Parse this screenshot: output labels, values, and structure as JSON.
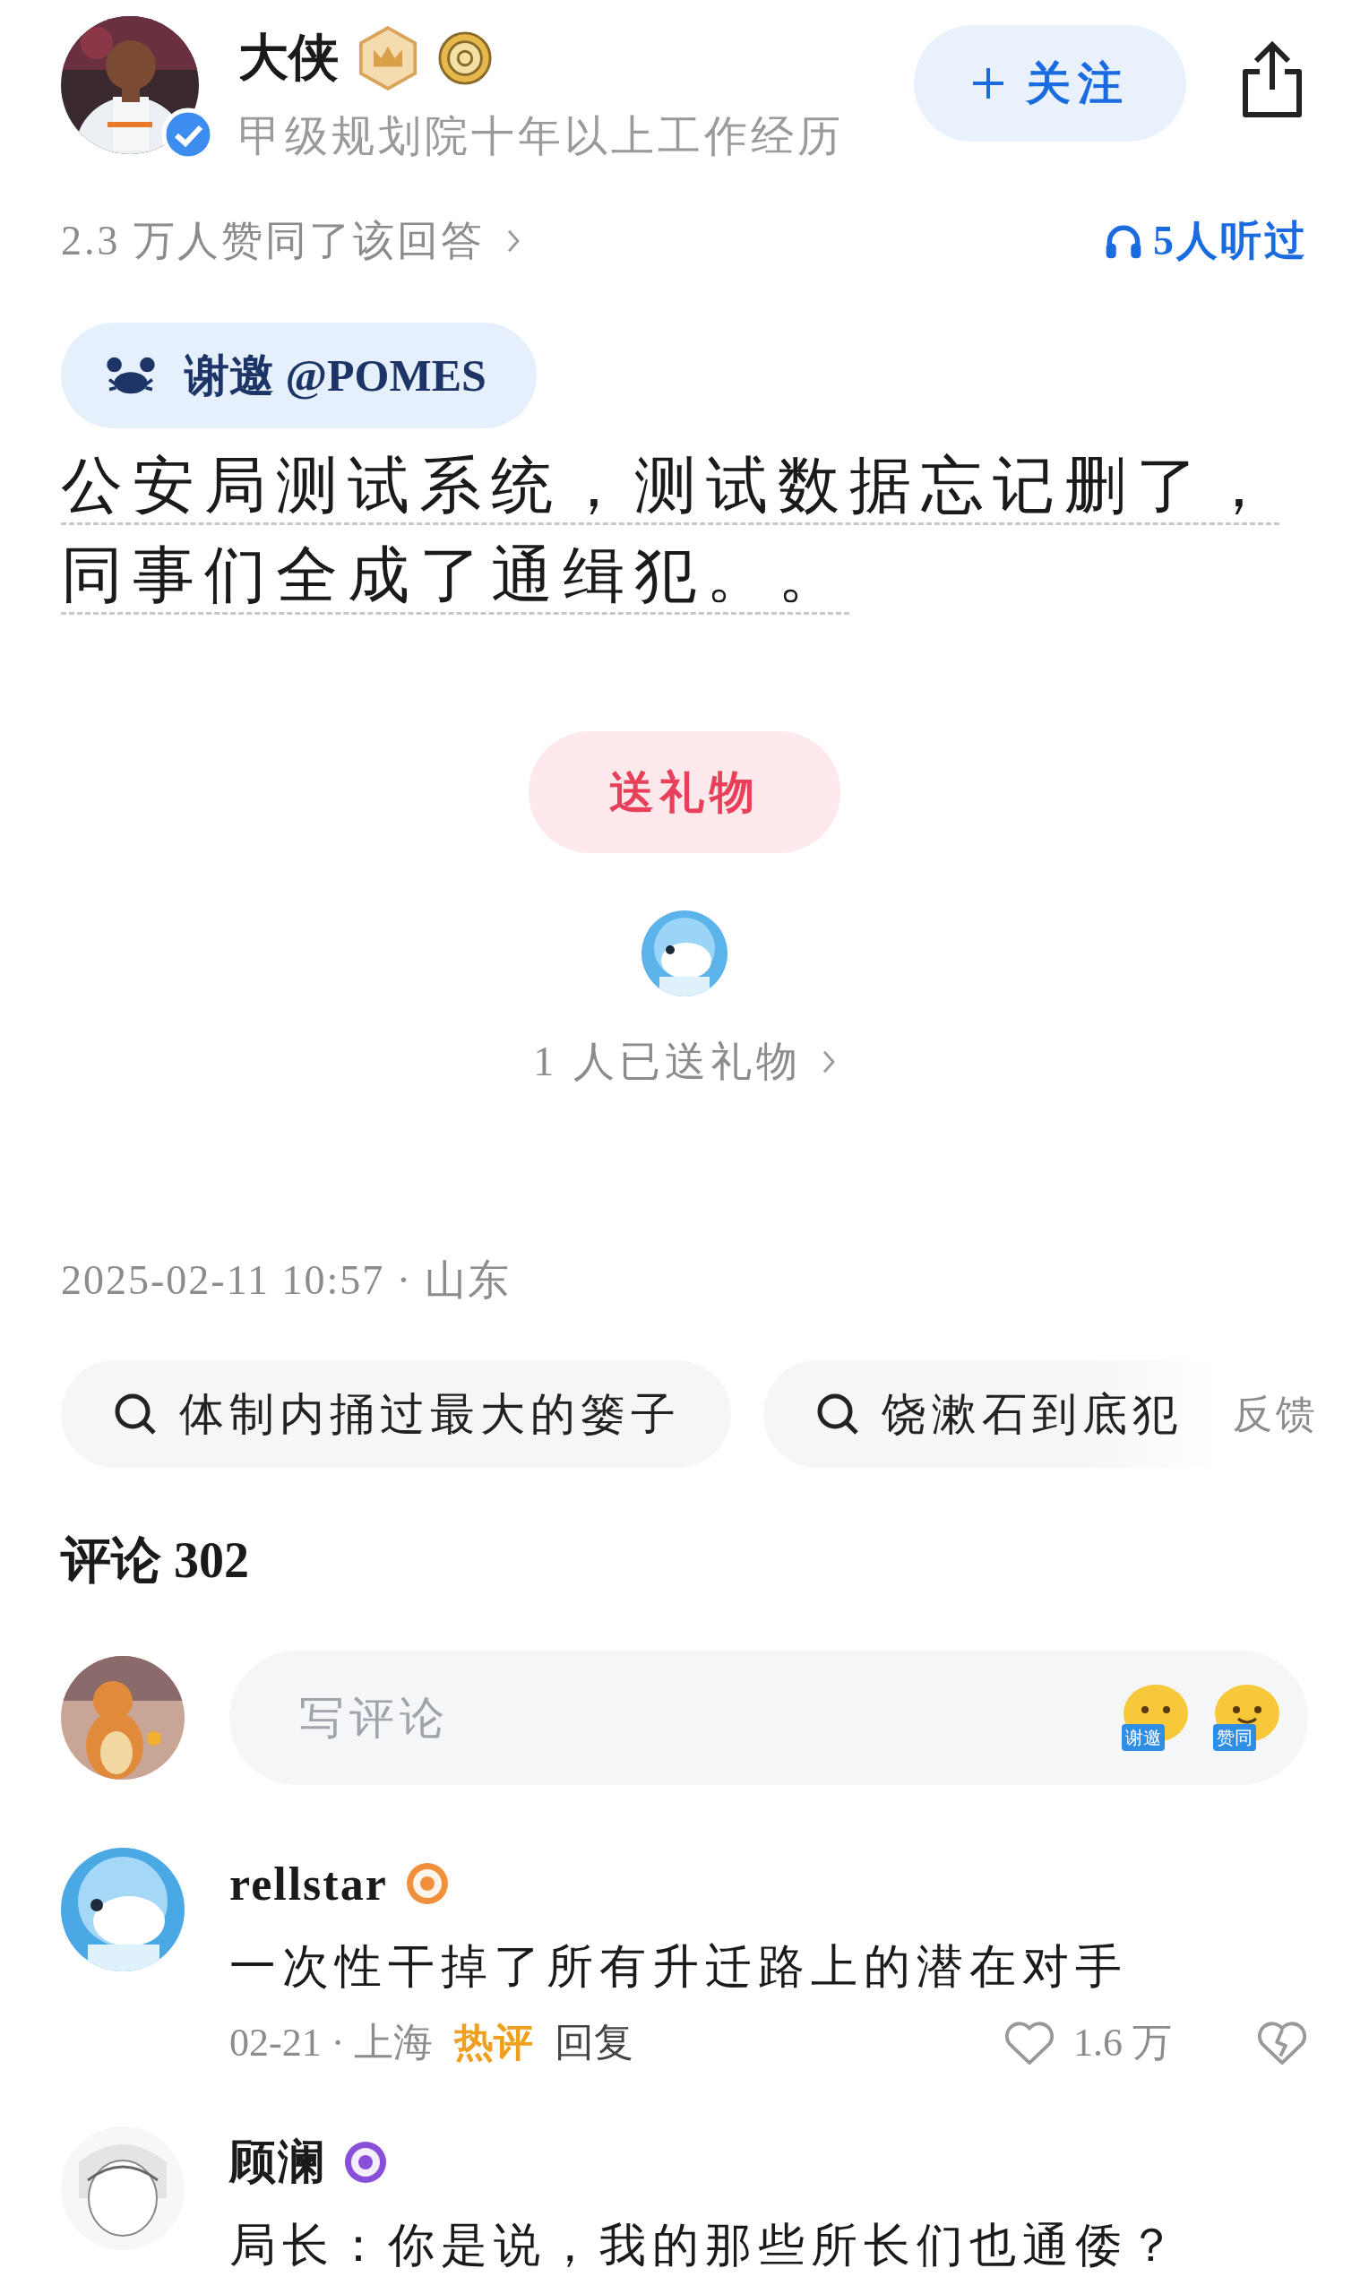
{
  "author": {
    "name": "大侠",
    "verified": true,
    "bio": "甲级规划院十年以上工作经历"
  },
  "follow_button": "关注",
  "approval": "2.3 万人赞同了该回答",
  "listened": "5人听过",
  "invite": "谢邀 @POMES",
  "answer": "公安局测试系统，测试数据忘记删了，同事们全成了通缉犯。。",
  "gift_button": "送礼物",
  "gift_count": "1 人已送礼物",
  "posted": "2025-02-11 10:57 · 山东",
  "search_chips": [
    "体制内捅过最大的篓子",
    "饶漱石到底犯"
  ],
  "feedback": "反馈",
  "comments_header": "评论 302",
  "comment_input": {
    "placeholder": "写评论",
    "stickers": [
      "谢邀",
      "赞同"
    ]
  },
  "comments": [
    {
      "author": "rellstar",
      "color": "#f0903c",
      "text": "一次性干掉了所有升迁路上的潜在对手",
      "meta": "02-21 · 上海",
      "hot_label": "热评",
      "reply": "回复",
      "likes": "1.6 万"
    },
    {
      "author": "顾澜",
      "color": "#8a4fd8",
      "text": "局长：你是说，我的那些所长们也通倭？"
    }
  ]
}
